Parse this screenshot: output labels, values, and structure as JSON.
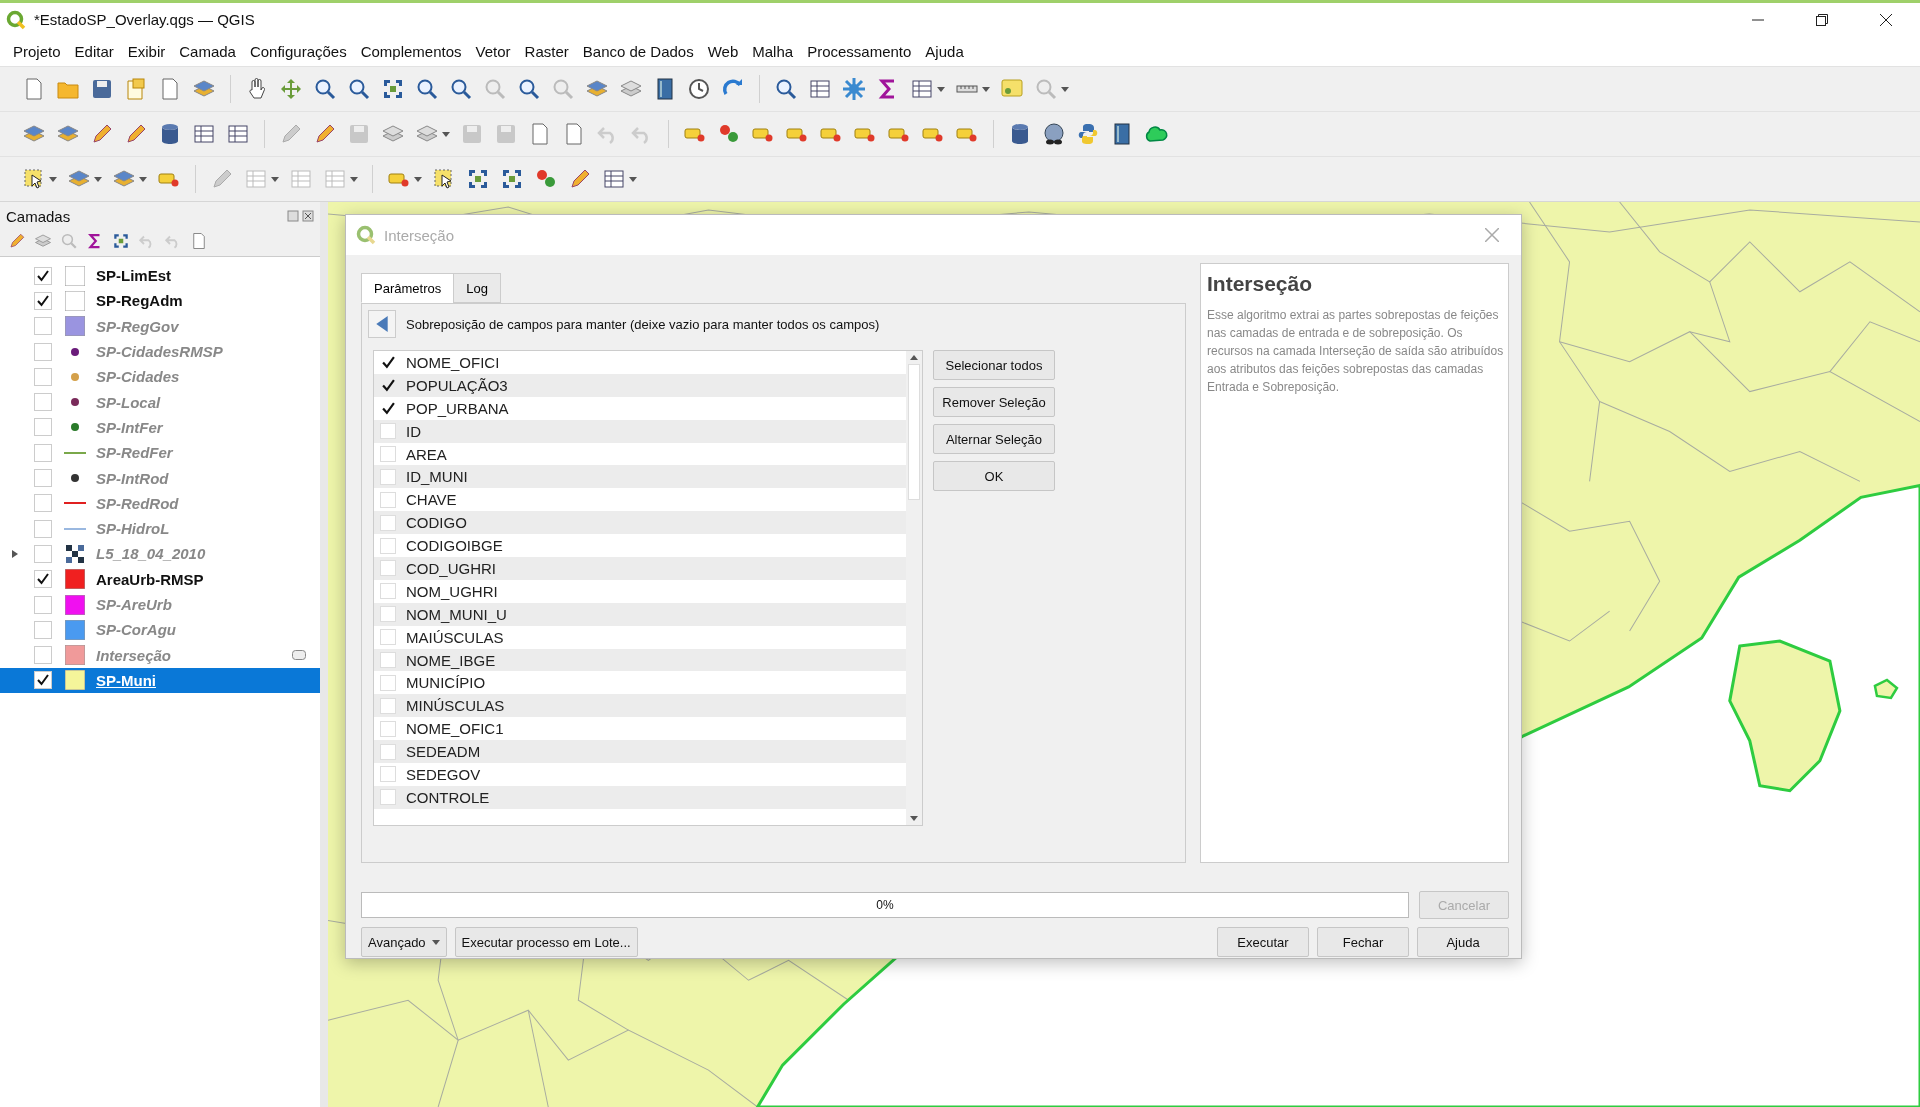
{
  "window": {
    "title": "*EstadoSP_Overlay.qgs — QGIS"
  },
  "menu": [
    "Projeto",
    "Editar",
    "Exibir",
    "Camada",
    "Configurações",
    "Complementos",
    "Vetor",
    "Raster",
    "Banco de Dados",
    "Web",
    "Malha",
    "Processamento",
    "Ajuda"
  ],
  "layers_panel": {
    "title": "Camadas",
    "layers": [
      {
        "name": "SP-LimEst",
        "checked": true,
        "kind": "fill",
        "color": "#ffffff",
        "expandable": false,
        "indicator": false,
        "selected": false
      },
      {
        "name": "SP-RegAdm",
        "checked": true,
        "kind": "fill",
        "color": "#ffffff",
        "expandable": false,
        "indicator": false,
        "selected": false
      },
      {
        "name": "SP-RegGov",
        "checked": false,
        "kind": "fill",
        "color": "#9a94e0",
        "expandable": false,
        "indicator": false,
        "selected": false
      },
      {
        "name": "SP-CidadesRMSP",
        "checked": false,
        "kind": "point",
        "color": "#6a1b7a",
        "expandable": false,
        "indicator": false,
        "selected": false
      },
      {
        "name": "SP-Cidades",
        "checked": false,
        "kind": "point",
        "color": "#d4a04a",
        "expandable": false,
        "indicator": false,
        "selected": false
      },
      {
        "name": "SP-Local",
        "checked": false,
        "kind": "point",
        "color": "#7a2a5a",
        "expandable": false,
        "indicator": false,
        "selected": false
      },
      {
        "name": "SP-IntFer",
        "checked": false,
        "kind": "point",
        "color": "#2a7a2a",
        "expandable": false,
        "indicator": false,
        "selected": false
      },
      {
        "name": "SP-RedFer",
        "checked": false,
        "kind": "line",
        "color": "#7aa84a",
        "expandable": false,
        "indicator": false,
        "selected": false
      },
      {
        "name": "SP-IntRod",
        "checked": false,
        "kind": "point",
        "color": "#333333",
        "expandable": false,
        "indicator": false,
        "selected": false
      },
      {
        "name": "SP-RedRod",
        "checked": false,
        "kind": "line",
        "color": "#e02020",
        "expandable": false,
        "indicator": false,
        "selected": false
      },
      {
        "name": "SP-HidroL",
        "checked": false,
        "kind": "line",
        "color": "#9ab8e0",
        "expandable": false,
        "indicator": false,
        "selected": false
      },
      {
        "name": "L5_18_04_2010",
        "checked": false,
        "kind": "raster",
        "expandable": true,
        "indicator": false,
        "selected": false
      },
      {
        "name": "AreaUrb-RMSP",
        "checked": true,
        "kind": "fill",
        "color": "#f02020",
        "expandable": false,
        "indicator": false,
        "selected": false
      },
      {
        "name": "SP-AreUrb",
        "checked": false,
        "kind": "fill",
        "color": "#f010f0",
        "expandable": false,
        "indicator": false,
        "selected": false
      },
      {
        "name": "SP-CorAgu",
        "checked": false,
        "kind": "fill",
        "color": "#4a9af0",
        "expandable": false,
        "indicator": false,
        "selected": false
      },
      {
        "name": "Interseção",
        "checked": false,
        "kind": "fill",
        "color": "#f09a9a",
        "expandable": false,
        "indicator": true,
        "selected": false
      },
      {
        "name": "SP-Muni",
        "checked": true,
        "kind": "fill",
        "color": "#f5f59a",
        "expandable": false,
        "indicator": false,
        "selected": true
      }
    ]
  },
  "dialog": {
    "title": "Interseção",
    "tabs": [
      {
        "label": "Parâmetros",
        "selected": true
      },
      {
        "label": "Log",
        "selected": false
      }
    ],
    "parameter_label": "Sobreposição de campos para manter (deixe vazio para manter todos os campos)",
    "fields": [
      {
        "name": "NOME_OFICI",
        "checked": true
      },
      {
        "name": "POPULAÇÃO3",
        "checked": true
      },
      {
        "name": "POP_URBANA",
        "checked": true
      },
      {
        "name": "ID",
        "checked": false
      },
      {
        "name": "AREA",
        "checked": false
      },
      {
        "name": "ID_MUNI",
        "checked": false
      },
      {
        "name": "CHAVE",
        "checked": false
      },
      {
        "name": "CODIGO",
        "checked": false
      },
      {
        "name": "CODIGOIBGE",
        "checked": false
      },
      {
        "name": "COD_UGHRI",
        "checked": false
      },
      {
        "name": "NOM_UGHRI",
        "checked": false
      },
      {
        "name": "NOM_MUNI_U",
        "checked": false
      },
      {
        "name": "MAIÚSCULAS",
        "checked": false
      },
      {
        "name": "NOME_IBGE",
        "checked": false
      },
      {
        "name": "MUNICÍPIO",
        "checked": false
      },
      {
        "name": "MINÚSCULAS",
        "checked": false
      },
      {
        "name": "NOME_OFIC1",
        "checked": false
      },
      {
        "name": "SEDEADM",
        "checked": false
      },
      {
        "name": "SEDEGOV",
        "checked": false
      },
      {
        "name": "CONTROLE",
        "checked": false
      }
    ],
    "side_buttons": [
      "Selecionar todos",
      "Remover Seleção",
      "Alternar Seleção",
      "OK"
    ],
    "help": {
      "title": "Interseção",
      "text": "Esse algoritmo extrai as partes sobrepostas de feições nas camadas de entrada e de sobreposição. Os recursos na camada Interseção de saída são atribuídos aos atributos das feições sobrepostas das camadas Entrada e Sobreposição."
    },
    "progress": {
      "level": 0,
      "text": "0%"
    },
    "cancel": {
      "label": "Cancelar",
      "disabled": true
    },
    "left_buttons": [
      {
        "label": "Avançado",
        "dropdown": true
      },
      {
        "label": "Executar processo em Lote...",
        "dropdown": false
      }
    ],
    "right_buttons": [
      "Executar",
      "Fechar",
      "Ajuda"
    ]
  }
}
